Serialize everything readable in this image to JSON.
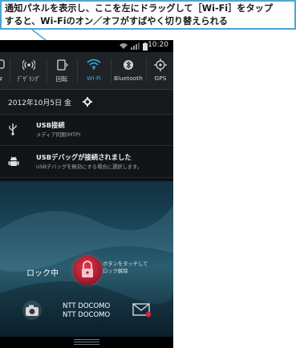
{
  "callout": {
    "line1": "通知パネルを表示し、ここを左にドラッグして［Wi-Fi］をタップ",
    "line2": "すると、Wi-Fiのオン／オフがすばやく切り替えられる"
  },
  "statusbar": {
    "time": "10:20"
  },
  "quick_settings": {
    "items": [
      {
        "label": "タ",
        "icon": "cut-off-icon"
      },
      {
        "label": "ﾃﾞｻﾞﾘﾝｸﾞ",
        "icon": "tethering-icon"
      },
      {
        "label": "回転",
        "icon": "rotate-icon"
      },
      {
        "label": "Wi-Fi",
        "icon": "wifi-icon"
      },
      {
        "label": "Bluetooth",
        "icon": "bluetooth-icon"
      },
      {
        "label": "GPS",
        "icon": "gps-icon"
      }
    ],
    "accent": "#33b5e5"
  },
  "date_row": {
    "date": "2012年10月5日 金"
  },
  "notifications": [
    {
      "title": "USB接続",
      "subtitle": "メディア同期(MTP)",
      "icon": "usb-icon"
    },
    {
      "title": "USBデバッグが接続されました",
      "subtitle": "USBデバッグを無効にする場合に選択します。",
      "icon": "android-icon"
    }
  ],
  "lockscreen": {
    "lock_text": "ロック中",
    "hint": "ボタンをタッチして\nロック解除",
    "carrier": "NTT DOCOMO\nNTT DOCOMO"
  }
}
